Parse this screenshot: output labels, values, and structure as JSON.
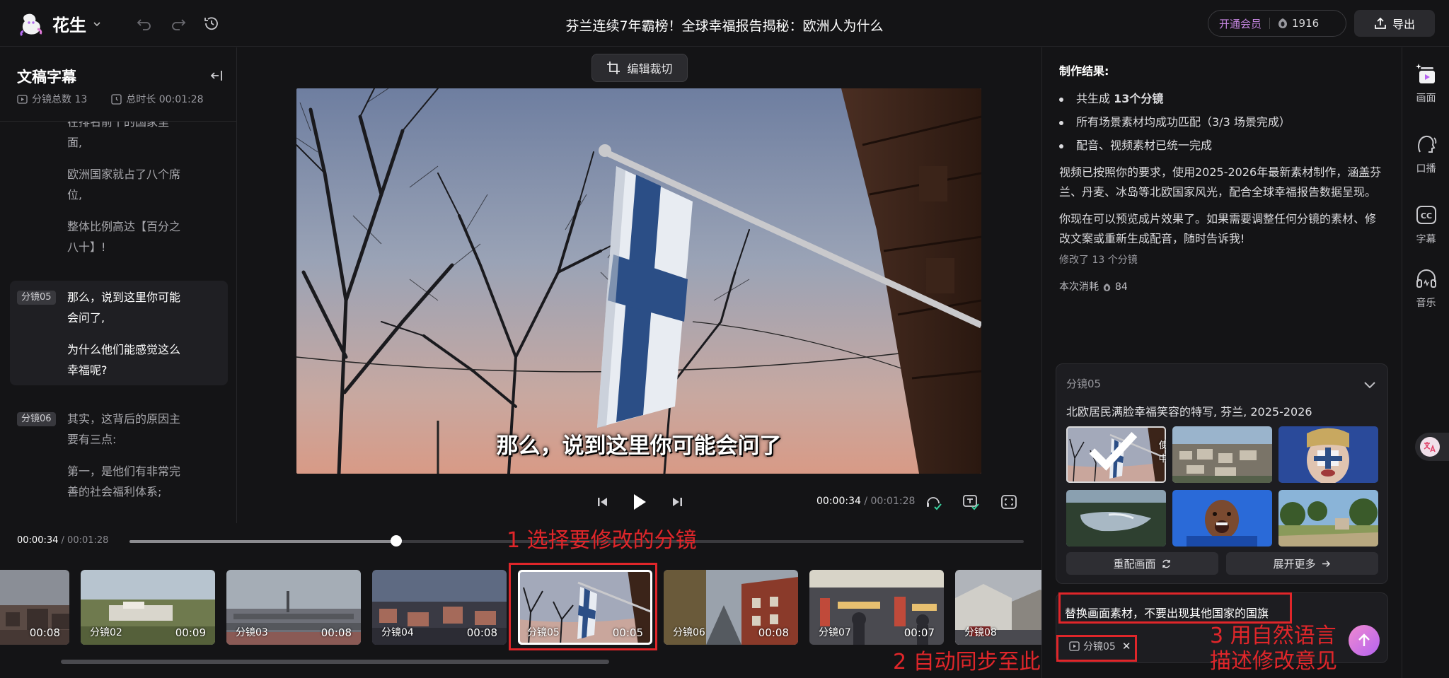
{
  "app": {
    "brand": "花生",
    "doc_title": "芬兰连续7年霸榜！全球幸福报告揭秘：欧洲人为什么",
    "member_label": "开通会员",
    "credits": "1916",
    "export_label": "导出"
  },
  "left_panel": {
    "title": "文稿字幕",
    "scene_count": "分镜总数 13",
    "total_duration": "总时长 00:01:28",
    "segments": [
      {
        "tag": "",
        "lines": [
          "在排名前十的国家里",
          "面,"
        ],
        "active": false
      },
      {
        "tag": "",
        "lines": [
          "欧洲国家就占了八个席",
          "位,"
        ],
        "active": false
      },
      {
        "tag": "",
        "lines": [
          "整体比例高达【百分之",
          "八十】!"
        ],
        "active": false
      },
      {
        "tag": "分镜05",
        "lines": [
          "那么，说到这里你可能",
          "会问了,"
        ],
        "active": true
      },
      {
        "tag": "",
        "lines": [
          "为什么他们能感觉这么",
          "幸福呢?"
        ],
        "active": true
      },
      {
        "tag": "分镜06",
        "lines": [
          "其实，这背后的原因主",
          "要有三点:"
        ],
        "active": false
      },
      {
        "tag": "",
        "lines": [
          "第一，是他们有非常完",
          "善的社会福利体系;"
        ],
        "active": false
      }
    ]
  },
  "player": {
    "crop_label": "编辑裁切",
    "subtitle": "那么，说到这里你可能会问了",
    "current_time": "00:00:34",
    "total_time": "/ 00:01:28"
  },
  "timeline": {
    "current_time": "00:00:34",
    "total_time": "/ 00:01:28",
    "progress": 0.298,
    "clips": [
      {
        "label": "",
        "duration": "00:08",
        "scene": "city"
      },
      {
        "label": "分镜02",
        "duration": "00:09",
        "scene": "aerial"
      },
      {
        "label": "分镜03",
        "duration": "00:08",
        "scene": "skyline"
      },
      {
        "label": "分镜04",
        "duration": "00:08",
        "scene": "dusk"
      },
      {
        "label": "分镜05",
        "duration": "00:05",
        "scene": "flag",
        "selected": true
      },
      {
        "label": "分镜06",
        "duration": "00:08",
        "scene": "street"
      },
      {
        "label": "分镜07",
        "duration": "00:07",
        "scene": "market"
      },
      {
        "label": "分镜08",
        "duration": "",
        "scene": "houses"
      }
    ]
  },
  "result": {
    "heading": "制作结果:",
    "bullet1_prefix": "共生成 ",
    "bullet1_bold": "13个分镜",
    "bullet2": "所有场景素材均成功匹配（3/3 场景完成）",
    "bullet3": "配音、视频素材已统一完成",
    "para1": "视频已按照你的要求，使用2025-2026年最新素材制作，涵盖芬兰、丹麦、冰岛等北欧国家风光，配合全球幸福报告数据呈现。",
    "para2": "你现在可以预览成片效果了。如果需要调整任何分镜的素材、修改文案或重新生成配音，随时告诉我!",
    "modified": "修改了 13 个分镜",
    "cost_label": "本次消耗",
    "cost_value": "84"
  },
  "scene_card": {
    "tag": "分镜05",
    "description": "北欧居民满脸幸福笑容的特写, 芬兰, 2025-2026",
    "in_use_label": "使用中",
    "rematch_label": "重配画面",
    "expand_label": "展开更多"
  },
  "composer": {
    "text": "替换画面素材，不要出现其他国家的国旗",
    "chip_label": "分镜05"
  },
  "rail": {
    "picture": "画面",
    "voice": "口播",
    "caption": "字幕",
    "music": "音乐"
  },
  "annotations": {
    "step1": "1 选择要修改的分镜",
    "step2": "2 自动同步至此",
    "step3_line1": "3 用自然语言",
    "step3_line2": "描述修改意见"
  },
  "colors": {
    "accent_pink": "#c586e0",
    "annotation_red": "#e0262a",
    "background": "#141416"
  }
}
